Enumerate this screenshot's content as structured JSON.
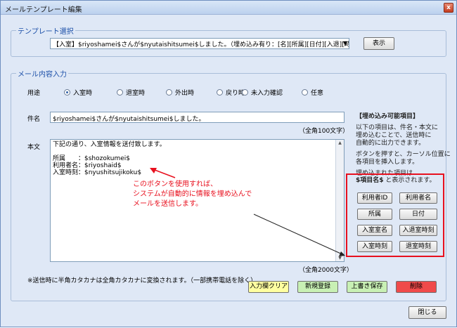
{
  "window": {
    "title": "メールテンプレート編集",
    "close_label": "x"
  },
  "template_section": {
    "legend": "テンプレート選択",
    "selected": "【入室】$riyoshamei$さんが$nyutaishitsumei$しました。（埋め込み有り：[名][所属][日付][入退][時刻]）",
    "show_button": "表示"
  },
  "mail_section": {
    "legend": "メール内容入力",
    "usage_label": "用途",
    "usage_options": [
      {
        "label": "入室時",
        "selected": true
      },
      {
        "label": "退室時",
        "selected": false
      },
      {
        "label": "外出時",
        "selected": false
      },
      {
        "label": "戻り時",
        "selected": false
      },
      {
        "label": "未入力確認",
        "selected": false
      },
      {
        "label": "任意",
        "selected": false
      }
    ],
    "subject_label": "件名",
    "subject_value": "$riyoshamei$さんが$nyutaishitsumei$しました。",
    "subject_limit": "（全角100文字）",
    "body_label": "本文",
    "body_lines": [
      "下記の通り、入室情報を送付致します。",
      "",
      "所属　　：$shozokumei$",
      "利用者名：$riyoshaid$",
      "入室時刻：$nyushitsujikoku$"
    ],
    "body_limit": "（全角2000文字）",
    "annotation": [
      "このボタンを使用すれば、",
      "システムが自動的に情報を埋め込んで",
      "メールを送信します。"
    ]
  },
  "embed_panel": {
    "title": "【埋め込み可能項目】",
    "desc": [
      "以下の項目は、件名・本文に",
      "埋め込むことで、送信時に",
      "自動的に出力できます。",
      "ボタンを押すと、カーソル位置に",
      "各項目を挿入します。",
      "埋め込まれた項目は"
    ],
    "format_token": "$項目名$",
    "format_suffix": "と表示されます。",
    "buttons": [
      "利用者ID",
      "利用者名",
      "所属",
      "日付",
      "入室室名",
      "入退室時刻",
      "入室時刻",
      "退室時刻"
    ]
  },
  "footer": {
    "note": "※送信時に半角カタカナは全角カタカナに変換されます。（一部携帯電話を除く）",
    "clear": "入力欄クリア",
    "new": "新規登録",
    "overwrite": "上書き保存",
    "delete": "削除",
    "close": "閉じる"
  },
  "colors": {
    "clear": "#ffffa0",
    "new": "#c8f0b4",
    "overwrite": "#c8f0b4",
    "delete": "#f04a4a",
    "accent": "#1b4fa8",
    "highlight": "#e8101e"
  }
}
